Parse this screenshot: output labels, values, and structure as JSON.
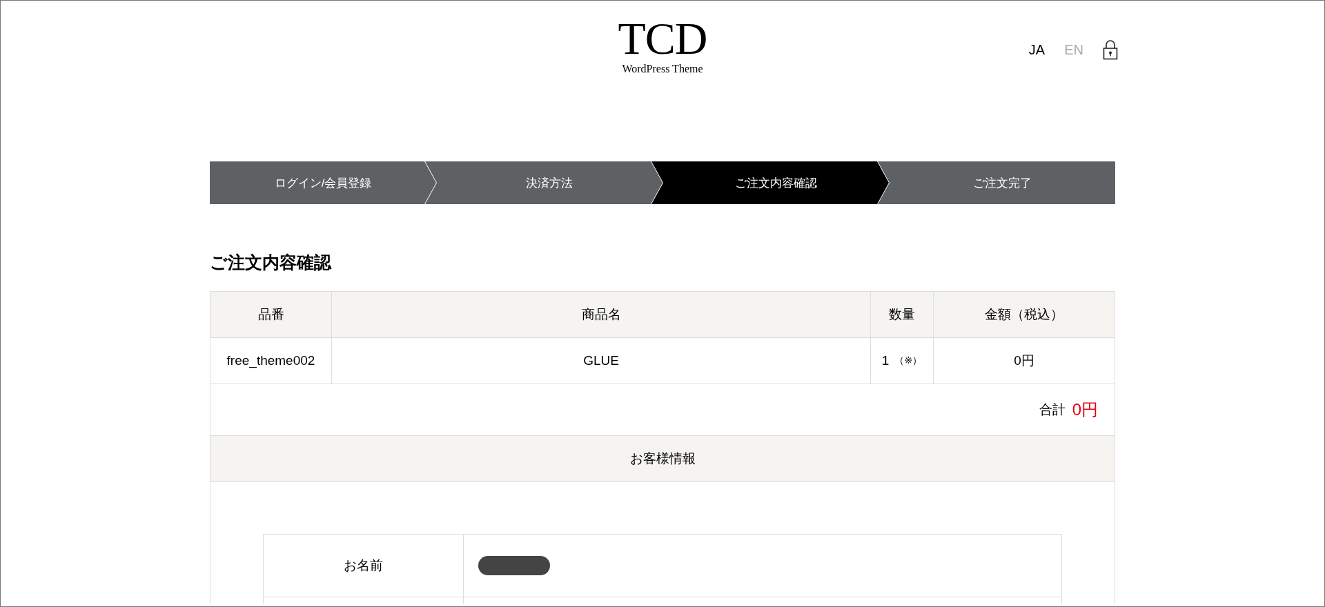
{
  "header": {
    "logo": "TCD",
    "tagline": "WordPress Theme",
    "languages": [
      {
        "label": "JA",
        "selected": true
      },
      {
        "label": "EN",
        "selected": false
      }
    ]
  },
  "steps": [
    {
      "label": "ログイン/会員登録",
      "selected": false
    },
    {
      "label": "決済方法",
      "selected": false
    },
    {
      "label": "ご注文内容確認",
      "selected": true
    },
    {
      "label": "ご注文完了",
      "selected": false
    }
  ],
  "heading": "ご注文内容確認",
  "order_table": {
    "columns": [
      "品番",
      "商品名",
      "数量",
      "金額（税込）"
    ],
    "rows": [
      {
        "code": "free_theme002",
        "name": "GLUE",
        "quantity": "1",
        "quantity_note": "（※）",
        "price": "0円"
      }
    ],
    "total_label": "合計",
    "total": "0円"
  },
  "customer": {
    "title": "お客様情報",
    "fields": [
      {
        "label": "お名前",
        "redacted": true
      }
    ]
  }
}
